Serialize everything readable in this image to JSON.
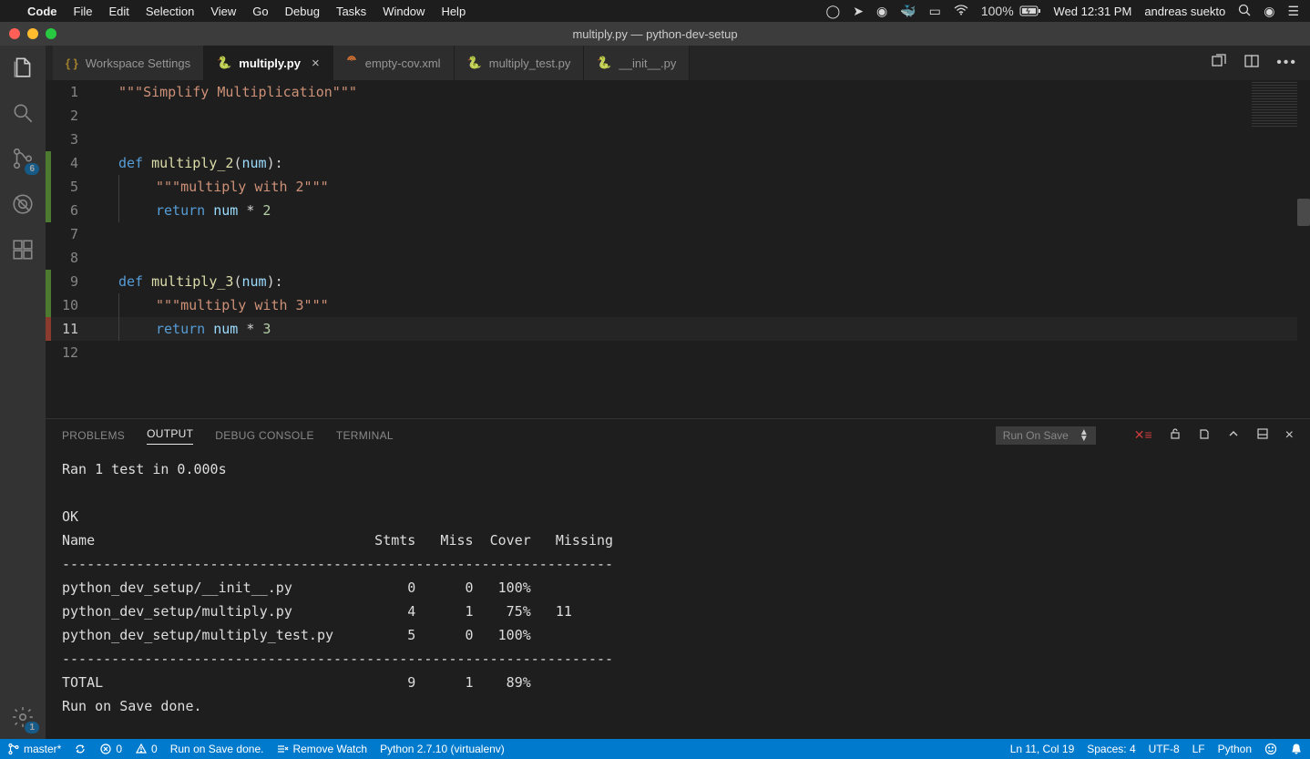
{
  "macmenu": {
    "app": "Code",
    "items": [
      "File",
      "Edit",
      "Selection",
      "View",
      "Go",
      "Debug",
      "Tasks",
      "Window",
      "Help"
    ],
    "battery": "100%",
    "clock": "Wed 12:31 PM",
    "user": "andreas suekto"
  },
  "window": {
    "title": "multiply.py — python-dev-setup"
  },
  "activity": {
    "scm_badge": "6",
    "settings_badge": "1"
  },
  "tabs": [
    {
      "label": "Workspace Settings",
      "icon": "braces"
    },
    {
      "label": "multiply.py",
      "icon": "python",
      "active": true,
      "dirty": false,
      "close": true
    },
    {
      "label": "empty-cov.xml",
      "icon": "xml"
    },
    {
      "label": "multiply_test.py",
      "icon": "python"
    },
    {
      "label": "__init__.py",
      "icon": "python"
    }
  ],
  "code": {
    "lines": [
      {
        "n": 1,
        "html": "<span class='str'>\"\"\"Simplify Multiplication\"\"\"</span>"
      },
      {
        "n": 2,
        "html": ""
      },
      {
        "n": 3,
        "html": ""
      },
      {
        "n": 4,
        "diff": "green",
        "html": "<span class='kw'>def</span> <span class='fn'>multiply_2</span><span class='txt'>(</span><span class='param'>num</span><span class='txt'>):</span>"
      },
      {
        "n": 5,
        "diff": "green",
        "indent": 1,
        "html": "<span class='str'>\"\"\"multiply with 2\"\"\"</span>"
      },
      {
        "n": 6,
        "diff": "green",
        "indent": 1,
        "html": "<span class='kw'>return</span> <span class='param'>num</span> <span class='op'>*</span> <span class='num-lit'>2</span>"
      },
      {
        "n": 7,
        "html": ""
      },
      {
        "n": 8,
        "html": ""
      },
      {
        "n": 9,
        "diff": "green",
        "html": "<span class='kw'>def</span> <span class='fn'>multiply_3</span><span class='txt'>(</span><span class='param'>num</span><span class='txt'>):</span>"
      },
      {
        "n": 10,
        "diff": "green",
        "indent": 1,
        "html": "<span class='str'>\"\"\"multiply with 3\"\"\"</span>"
      },
      {
        "n": 11,
        "diff": "red",
        "indent": 1,
        "current": true,
        "html": "<span class='kw'>return</span> <span class='param'>num</span> <span class='op'>*</span> <span class='num-lit'>3</span>"
      },
      {
        "n": 12,
        "html": ""
      }
    ]
  },
  "panel": {
    "tabs": [
      "PROBLEMS",
      "OUTPUT",
      "DEBUG CONSOLE",
      "TERMINAL"
    ],
    "active_tab": "OUTPUT",
    "select": "Run On Save",
    "output": "Ran 1 test in 0.000s\n\nOK\nName                                  Stmts   Miss  Cover   Missing\n-------------------------------------------------------------------\npython_dev_setup/__init__.py              0      0   100%\npython_dev_setup/multiply.py              4      1    75%   11\npython_dev_setup/multiply_test.py         5      0   100%\n-------------------------------------------------------------------\nTOTAL                                     9      1    89%\nRun on Save done."
  },
  "status": {
    "branch": "master*",
    "errors": "0",
    "warnings": "0",
    "run_on_save": "Run on Save done.",
    "remove_watch": "Remove Watch",
    "python": "Python 2.7.10 (virtualenv)",
    "position": "Ln 11, Col 19",
    "spaces": "Spaces: 4",
    "encoding": "UTF-8",
    "eol": "LF",
    "language": "Python"
  }
}
